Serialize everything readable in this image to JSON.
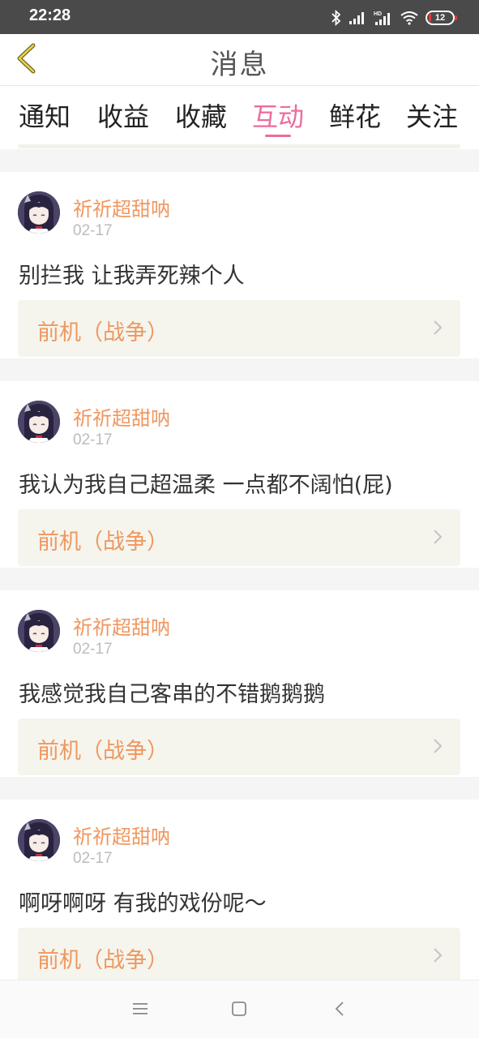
{
  "status_bar": {
    "time": "22:28",
    "battery_level": "12"
  },
  "header": {
    "title": "消息"
  },
  "tabs": [
    {
      "label": "通知"
    },
    {
      "label": "收益"
    },
    {
      "label": "收藏"
    },
    {
      "label": "互动",
      "active": true
    },
    {
      "label": "鲜花"
    },
    {
      "label": "关注"
    }
  ],
  "colors": {
    "accent": "#ee6b9e",
    "name_color": "#f0975f"
  },
  "items": [
    {
      "name": "祈祈超甜呐",
      "date": "02-17",
      "message": "别拦我 让我弄死辣个人",
      "ref_title": "前机（战争）"
    },
    {
      "name": "祈祈超甜呐",
      "date": "02-17",
      "message": "我认为我自己超温柔 一点都不阔怕(屁)",
      "ref_title": "前机（战争）"
    },
    {
      "name": "祈祈超甜呐",
      "date": "02-17",
      "message": "我感觉我自己客串的不错鹅鹅鹅",
      "ref_title": "前机（战争）"
    },
    {
      "name": "祈祈超甜呐",
      "date": "02-17",
      "message": "啊呀啊呀 有我的戏份呢～",
      "ref_title": "前机（战争）"
    }
  ],
  "nav_icons": [
    "menu-icon",
    "home-square-icon",
    "back-chevron-icon"
  ]
}
